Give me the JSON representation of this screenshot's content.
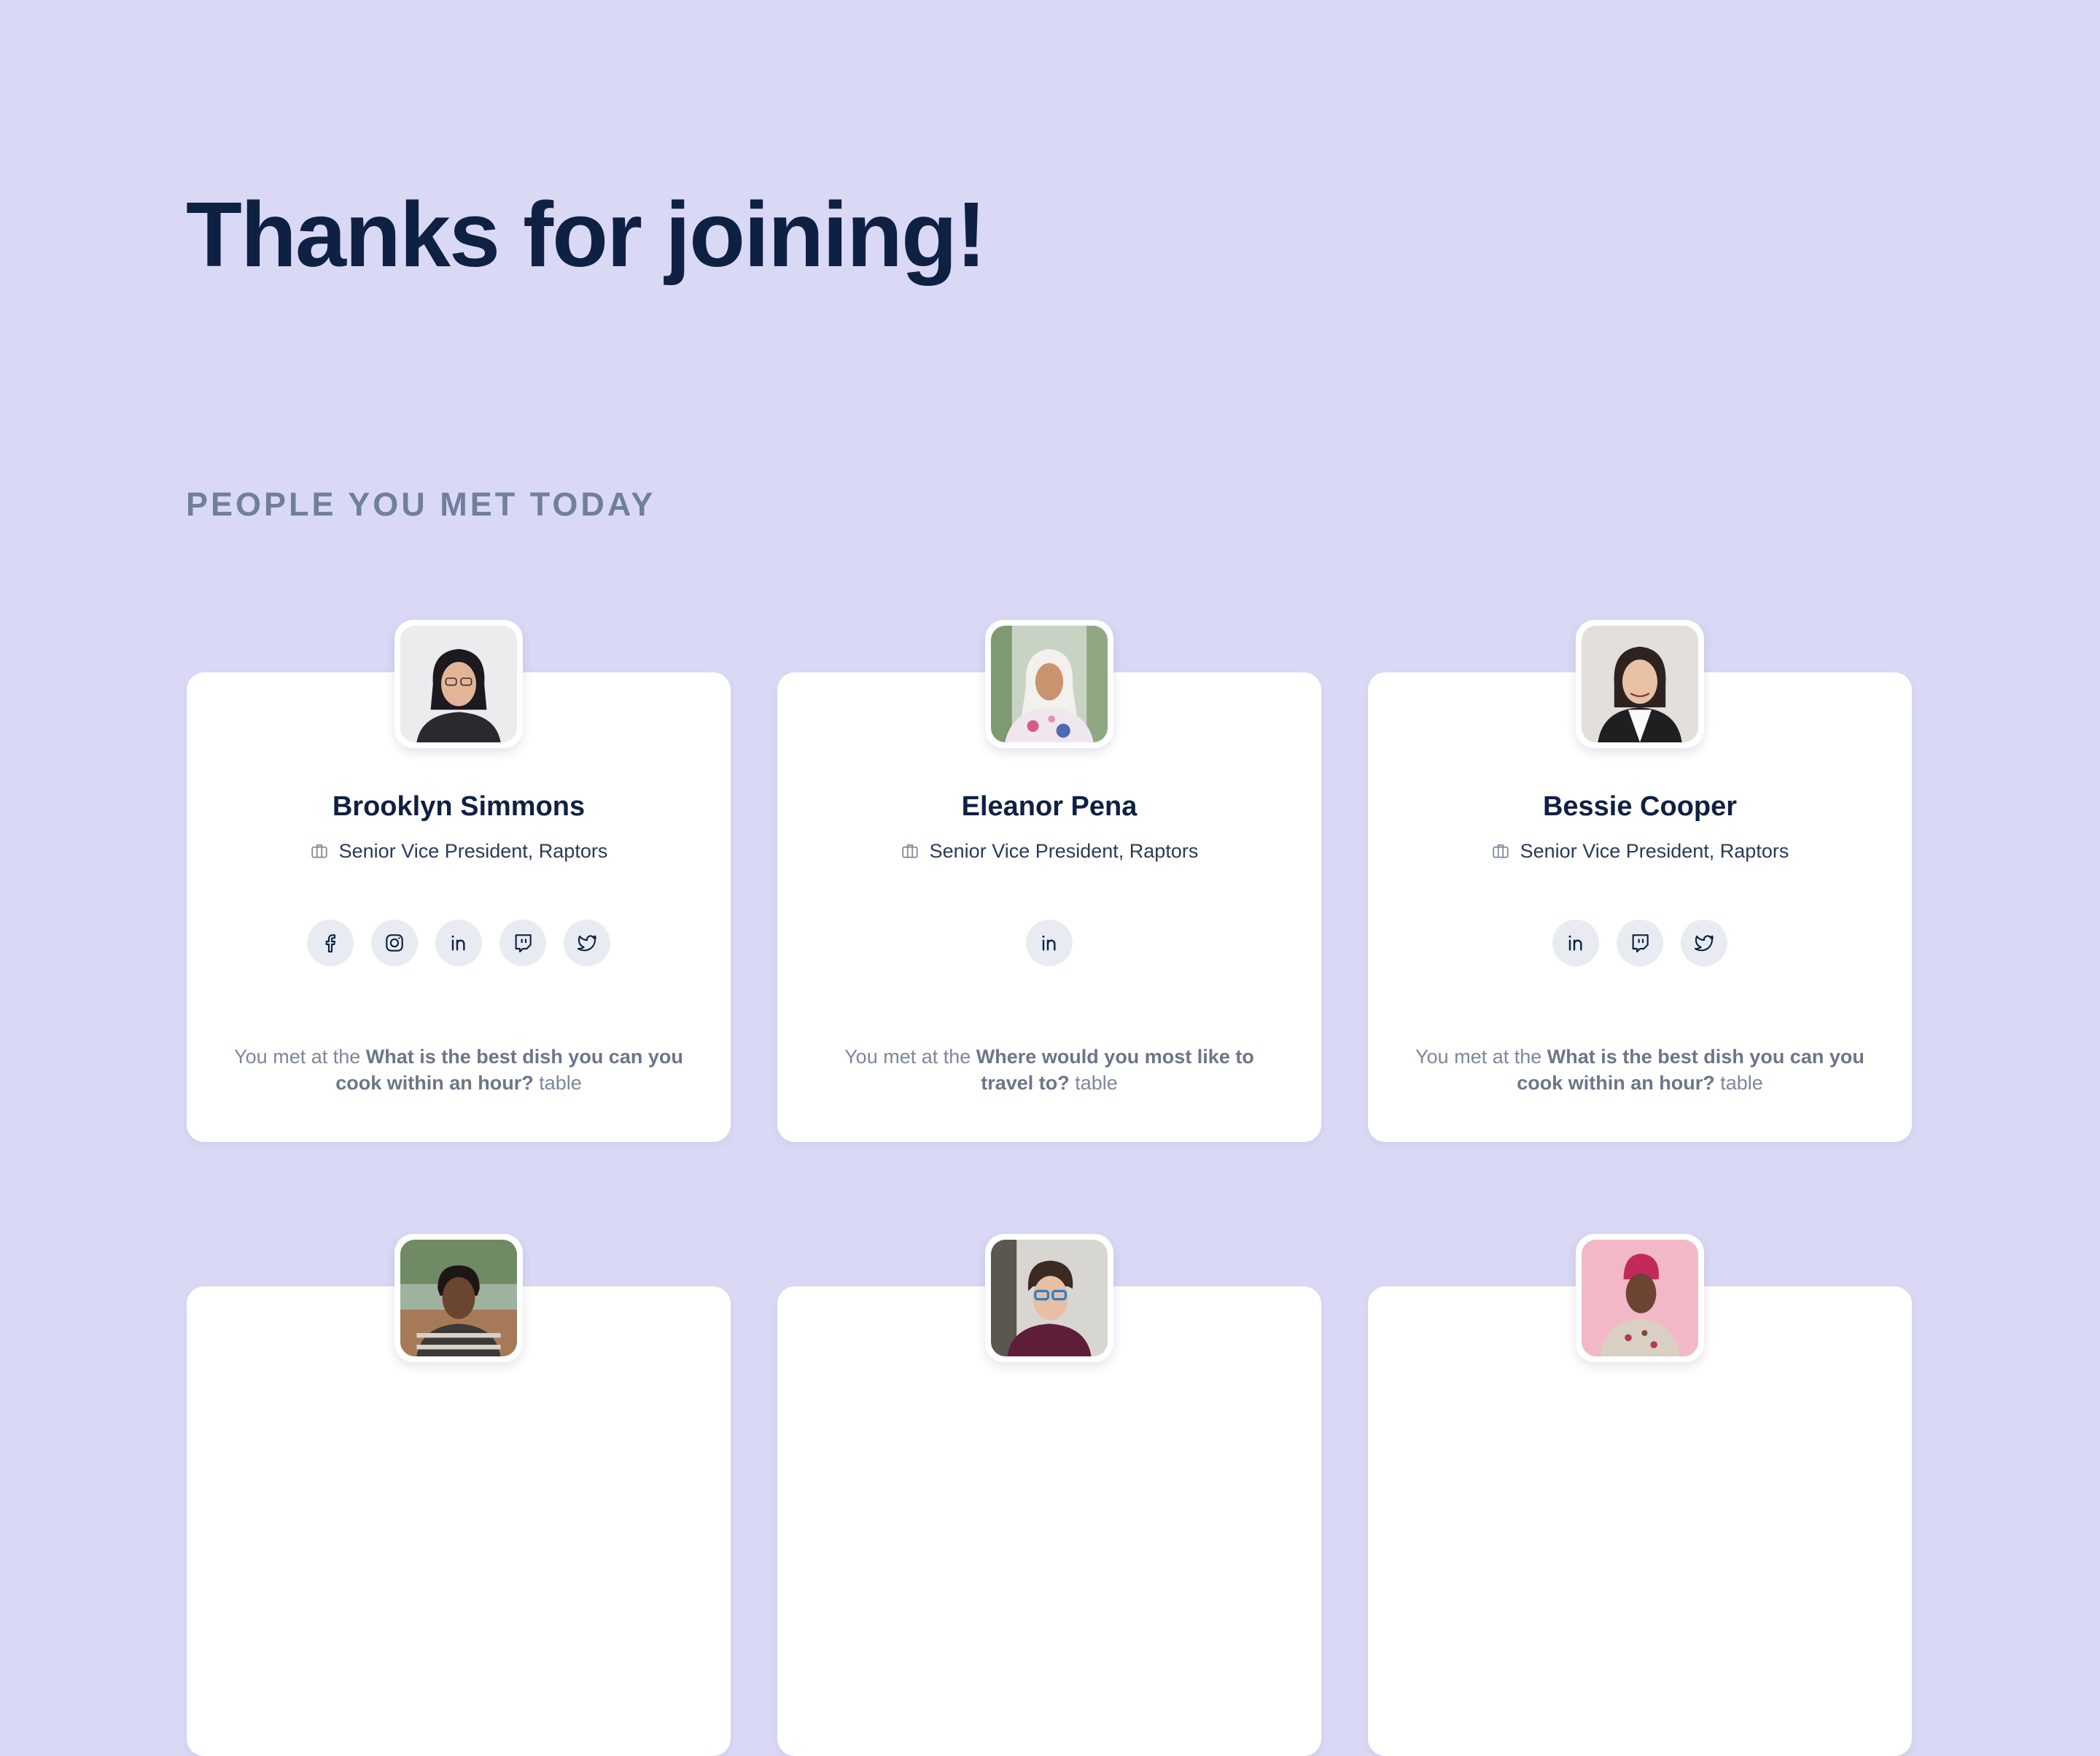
{
  "page": {
    "title": "Thanks for joining!",
    "section_title": "PEOPLE YOU MET TODAY"
  },
  "colors": {
    "background": "#D9D9F6",
    "card": "#FFFFFF",
    "heading": "#0F2142",
    "section_title": "#70809C",
    "social_bg": "#E8ECF2",
    "muted_text": "#7D879A"
  },
  "people": [
    {
      "name": "Brooklyn Simmons",
      "role": "Senior Vice President, Raptors",
      "role_icon": "briefcase-icon",
      "socials": [
        "facebook",
        "instagram",
        "linkedin",
        "twitch",
        "twitter"
      ],
      "met_prefix": "You met at the ",
      "table_name": "What is the best dish you can you cook within an hour?",
      "met_suffix": " table"
    },
    {
      "name": "Eleanor Pena",
      "role": "Senior Vice President, Raptors",
      "role_icon": "briefcase-icon",
      "socials": [
        "linkedin"
      ],
      "met_prefix": "You met at the ",
      "table_name": "Where would you most like to travel to?",
      "met_suffix": " table"
    },
    {
      "name": "Bessie Cooper",
      "role": "Senior Vice President, Raptors",
      "role_icon": "briefcase-icon",
      "socials": [
        "linkedin",
        "twitch",
        "twitter"
      ],
      "met_prefix": "You met at the ",
      "table_name": "What is the best dish you can you cook within an hour?",
      "met_suffix": " table"
    },
    {
      "name": "",
      "role": "",
      "socials": [],
      "met_prefix": "",
      "table_name": "",
      "met_suffix": ""
    },
    {
      "name": "",
      "role": "",
      "socials": [],
      "met_prefix": "",
      "table_name": "",
      "met_suffix": ""
    },
    {
      "name": "",
      "role": "",
      "socials": [],
      "met_prefix": "",
      "table_name": "",
      "met_suffix": ""
    }
  ]
}
